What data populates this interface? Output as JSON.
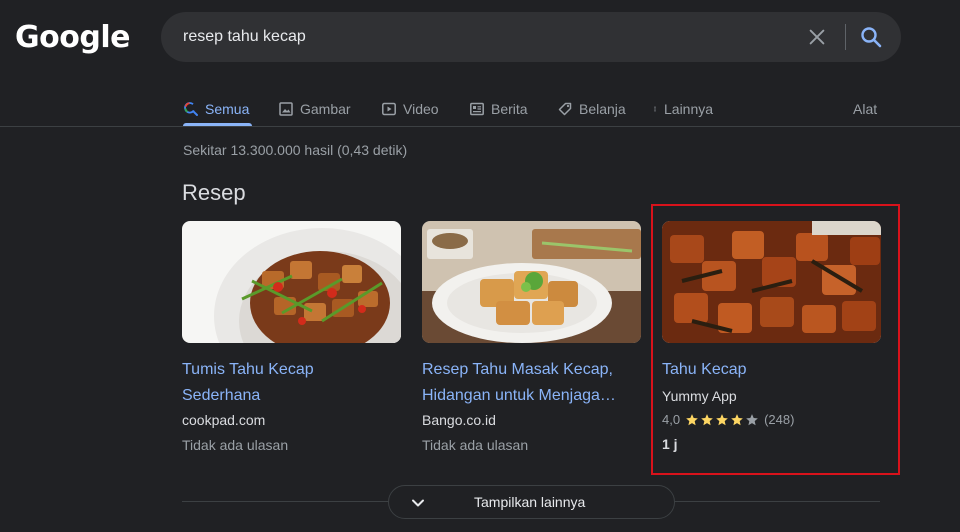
{
  "logo": {
    "text": "Google"
  },
  "search": {
    "query": "resep tahu kecap"
  },
  "tabs": [
    {
      "label": "Semua",
      "icon": "search-icon",
      "active": true
    },
    {
      "label": "Gambar",
      "icon": "image-icon"
    },
    {
      "label": "Video",
      "icon": "play-icon"
    },
    {
      "label": "Berita",
      "icon": "news-icon"
    },
    {
      "label": "Belanja",
      "icon": "tag-icon"
    },
    {
      "label": "Lainnya",
      "icon": "more-vert-icon"
    }
  ],
  "tools_label": "Alat",
  "result_stats": "Sekitar 13.300.000 hasil (0,43 detik)",
  "section_title": "Resep",
  "recipes": [
    {
      "title": "Tumis Tahu Kecap Sederhana",
      "source": "cookpad.com",
      "reviews": "Tidak ada ulasan"
    },
    {
      "title": "Resep Tahu Masak Kecap, Hidangan untuk Menjaga…",
      "source": "Bango.co.id",
      "reviews": "Tidak ada ulasan"
    },
    {
      "title": "Tahu Kecap",
      "source": "Yummy App",
      "rating_value": "4,0",
      "rating": 4,
      "rating_count": "(248)",
      "time": "1 j"
    }
  ],
  "show_more_label": "Tampilkan lainnya",
  "colors": {
    "background": "#202124",
    "link": "#8ab4f8",
    "star": "#fdd663",
    "highlight": "#d8121b"
  }
}
